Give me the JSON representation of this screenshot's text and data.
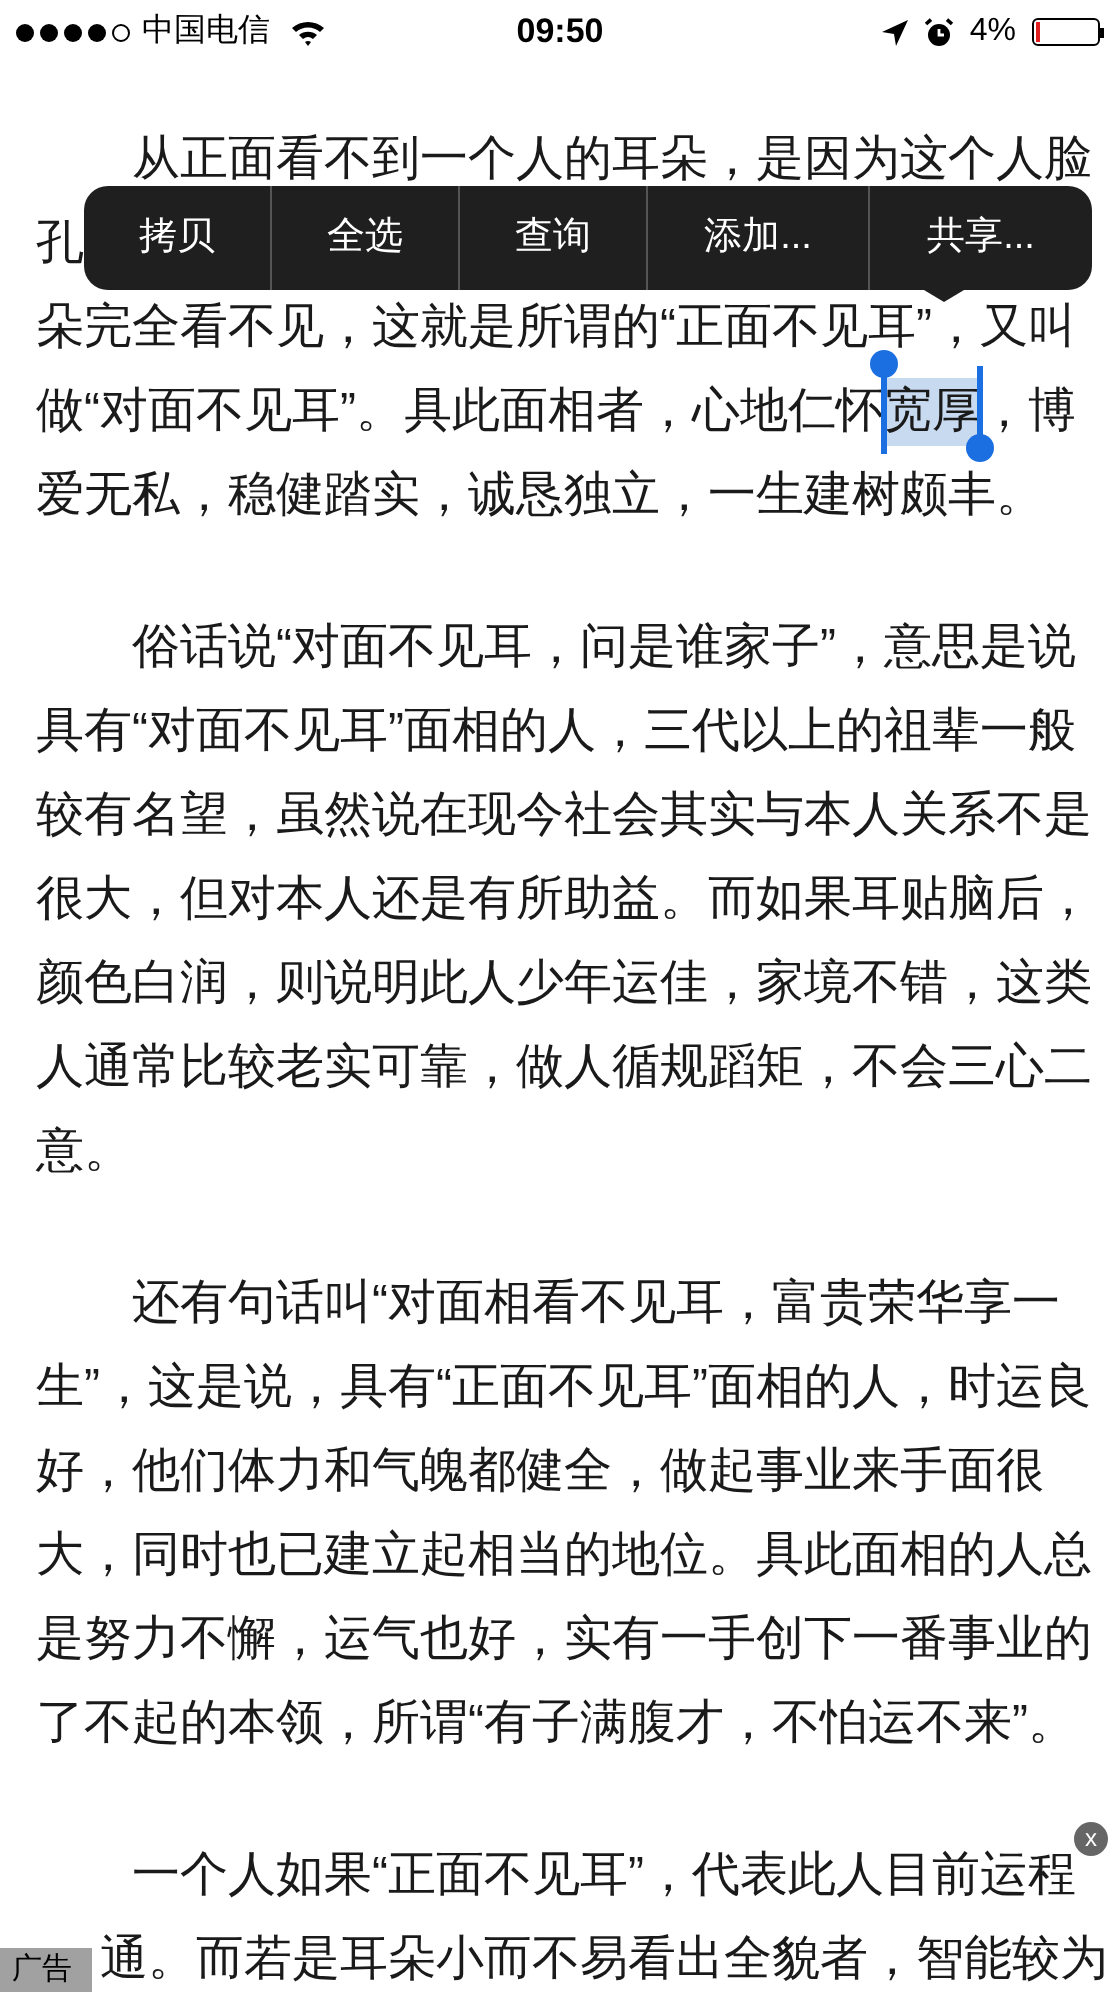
{
  "status_bar": {
    "carrier": "中国电信",
    "time": "09:50",
    "battery": "4%",
    "signal_dots": [
      {
        "filled": true
      },
      {
        "filled": true
      },
      {
        "filled": true
      },
      {
        "filled": true
      },
      {
        "filled": false
      }
    ]
  },
  "edit_menu": {
    "items": [
      "拷贝",
      "全选",
      "查询",
      "添加...",
      "共享..."
    ]
  },
  "paragraphs": [
    {
      "lines": [
        "从正面看不到一个人的耳朵，是因为这个人脸",
        "孔",
        "朵完全看不见，这就是所谓的“正面不见耳”，又叫",
        [
          {
            "text": "做“对面不见耳”。具此面相者，心地仁怀",
            "selected": false
          },
          {
            "text": "宽厚",
            "selected": true
          },
          {
            "text": "，博",
            "selected": false
          }
        ],
        "爱无私，稳健踏实，诚恳独立，一生建树颇丰。"
      ]
    },
    {
      "lines": [
        "俗话说“对面不见耳，问是谁家子”，意思是说",
        "具有“对面不见耳”面相的人，三代以上的祖辈一般",
        "较有名望，虽然说在现今社会其实与本人关系不是",
        "很大，但对本人还是有所助益。而如果耳贴脑后，",
        "颜色白润，则说明此人少年运佳，家境不错，这类",
        "人通常比较老实可靠，做人循规蹈矩，不会三心二",
        "意。"
      ]
    },
    {
      "lines": [
        "还有句话叫“对面相看不见耳，富贵荣华享一",
        "生”，这是说，具有“正面不见耳”面相的人，时运良",
        "好，他们体力和气魄都健全，做起事业来手面很",
        "大，同时也已建立起相当的地位。具此面相的人总",
        "是努力不懈，运气也好，实有一手创下一番事业的",
        "了不起的本领，所谓“有子满腹才，不怕运不来”。"
      ]
    },
    {
      "lines": [
        "一个人如果“正面不见耳”，代表此人目前运程",
        "通。而若是耳朵小而不易看出全貌者，智能较为"
      ]
    }
  ],
  "ad": {
    "label": "广告",
    "close": "x"
  }
}
